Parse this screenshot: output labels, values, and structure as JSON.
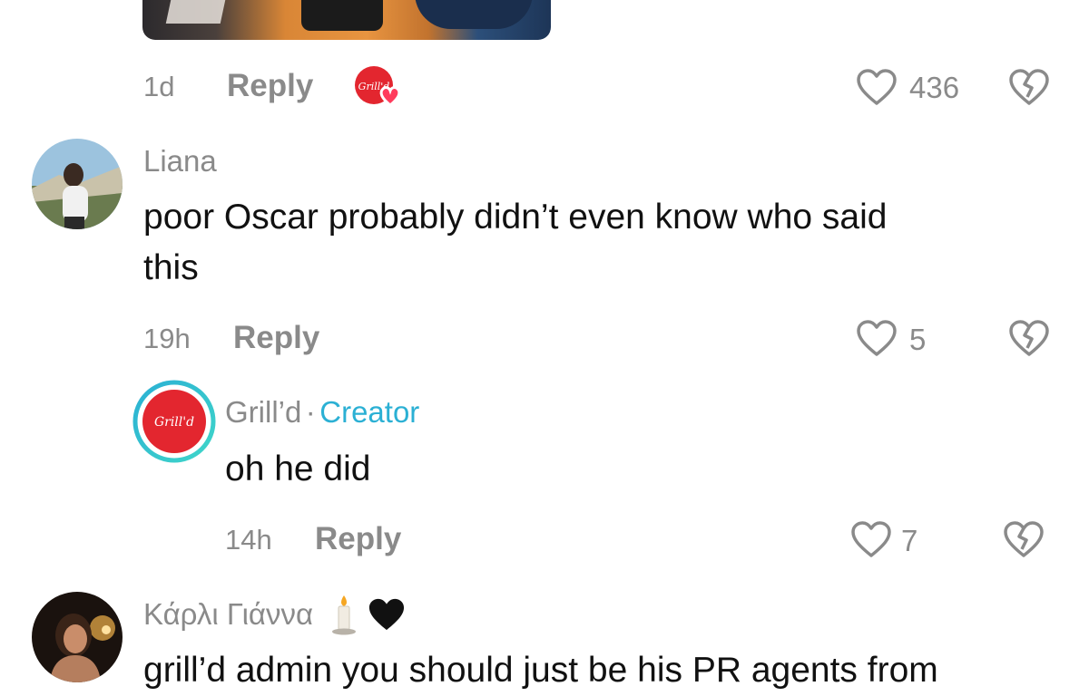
{
  "comments": [
    {
      "time": "1d",
      "reply_label": "Reply",
      "creator_like_badge": "Grill'd",
      "likes": "436",
      "icons": {
        "like": "heart-outline-icon",
        "dislike": "broken-heart-icon"
      }
    },
    {
      "username": "Liana",
      "text_line1": "poor Oscar probably didn’t even know who said",
      "text_line2": "this",
      "time": "19h",
      "reply_label": "Reply",
      "likes": "5",
      "replies": [
        {
          "username": "Grill’d",
          "separator": "·",
          "creator_label": "Creator",
          "avatar_logo_text": "Grill'd",
          "text": "oh he did",
          "time": "14h",
          "reply_label": "Reply",
          "likes": "7"
        }
      ]
    },
    {
      "username": "Κάρλι Γιάννα",
      "username_emojis": [
        "candle-emoji",
        "black-heart-emoji"
      ],
      "text": "grill’d admin you should just be his PR agents from"
    }
  ],
  "colors": {
    "muted_text": "#8a8a8a",
    "body_text": "#111111",
    "creator_accent": "#2bb0d4",
    "brand_red": "#e3262f",
    "heart_pink": "#ff3b5c"
  }
}
